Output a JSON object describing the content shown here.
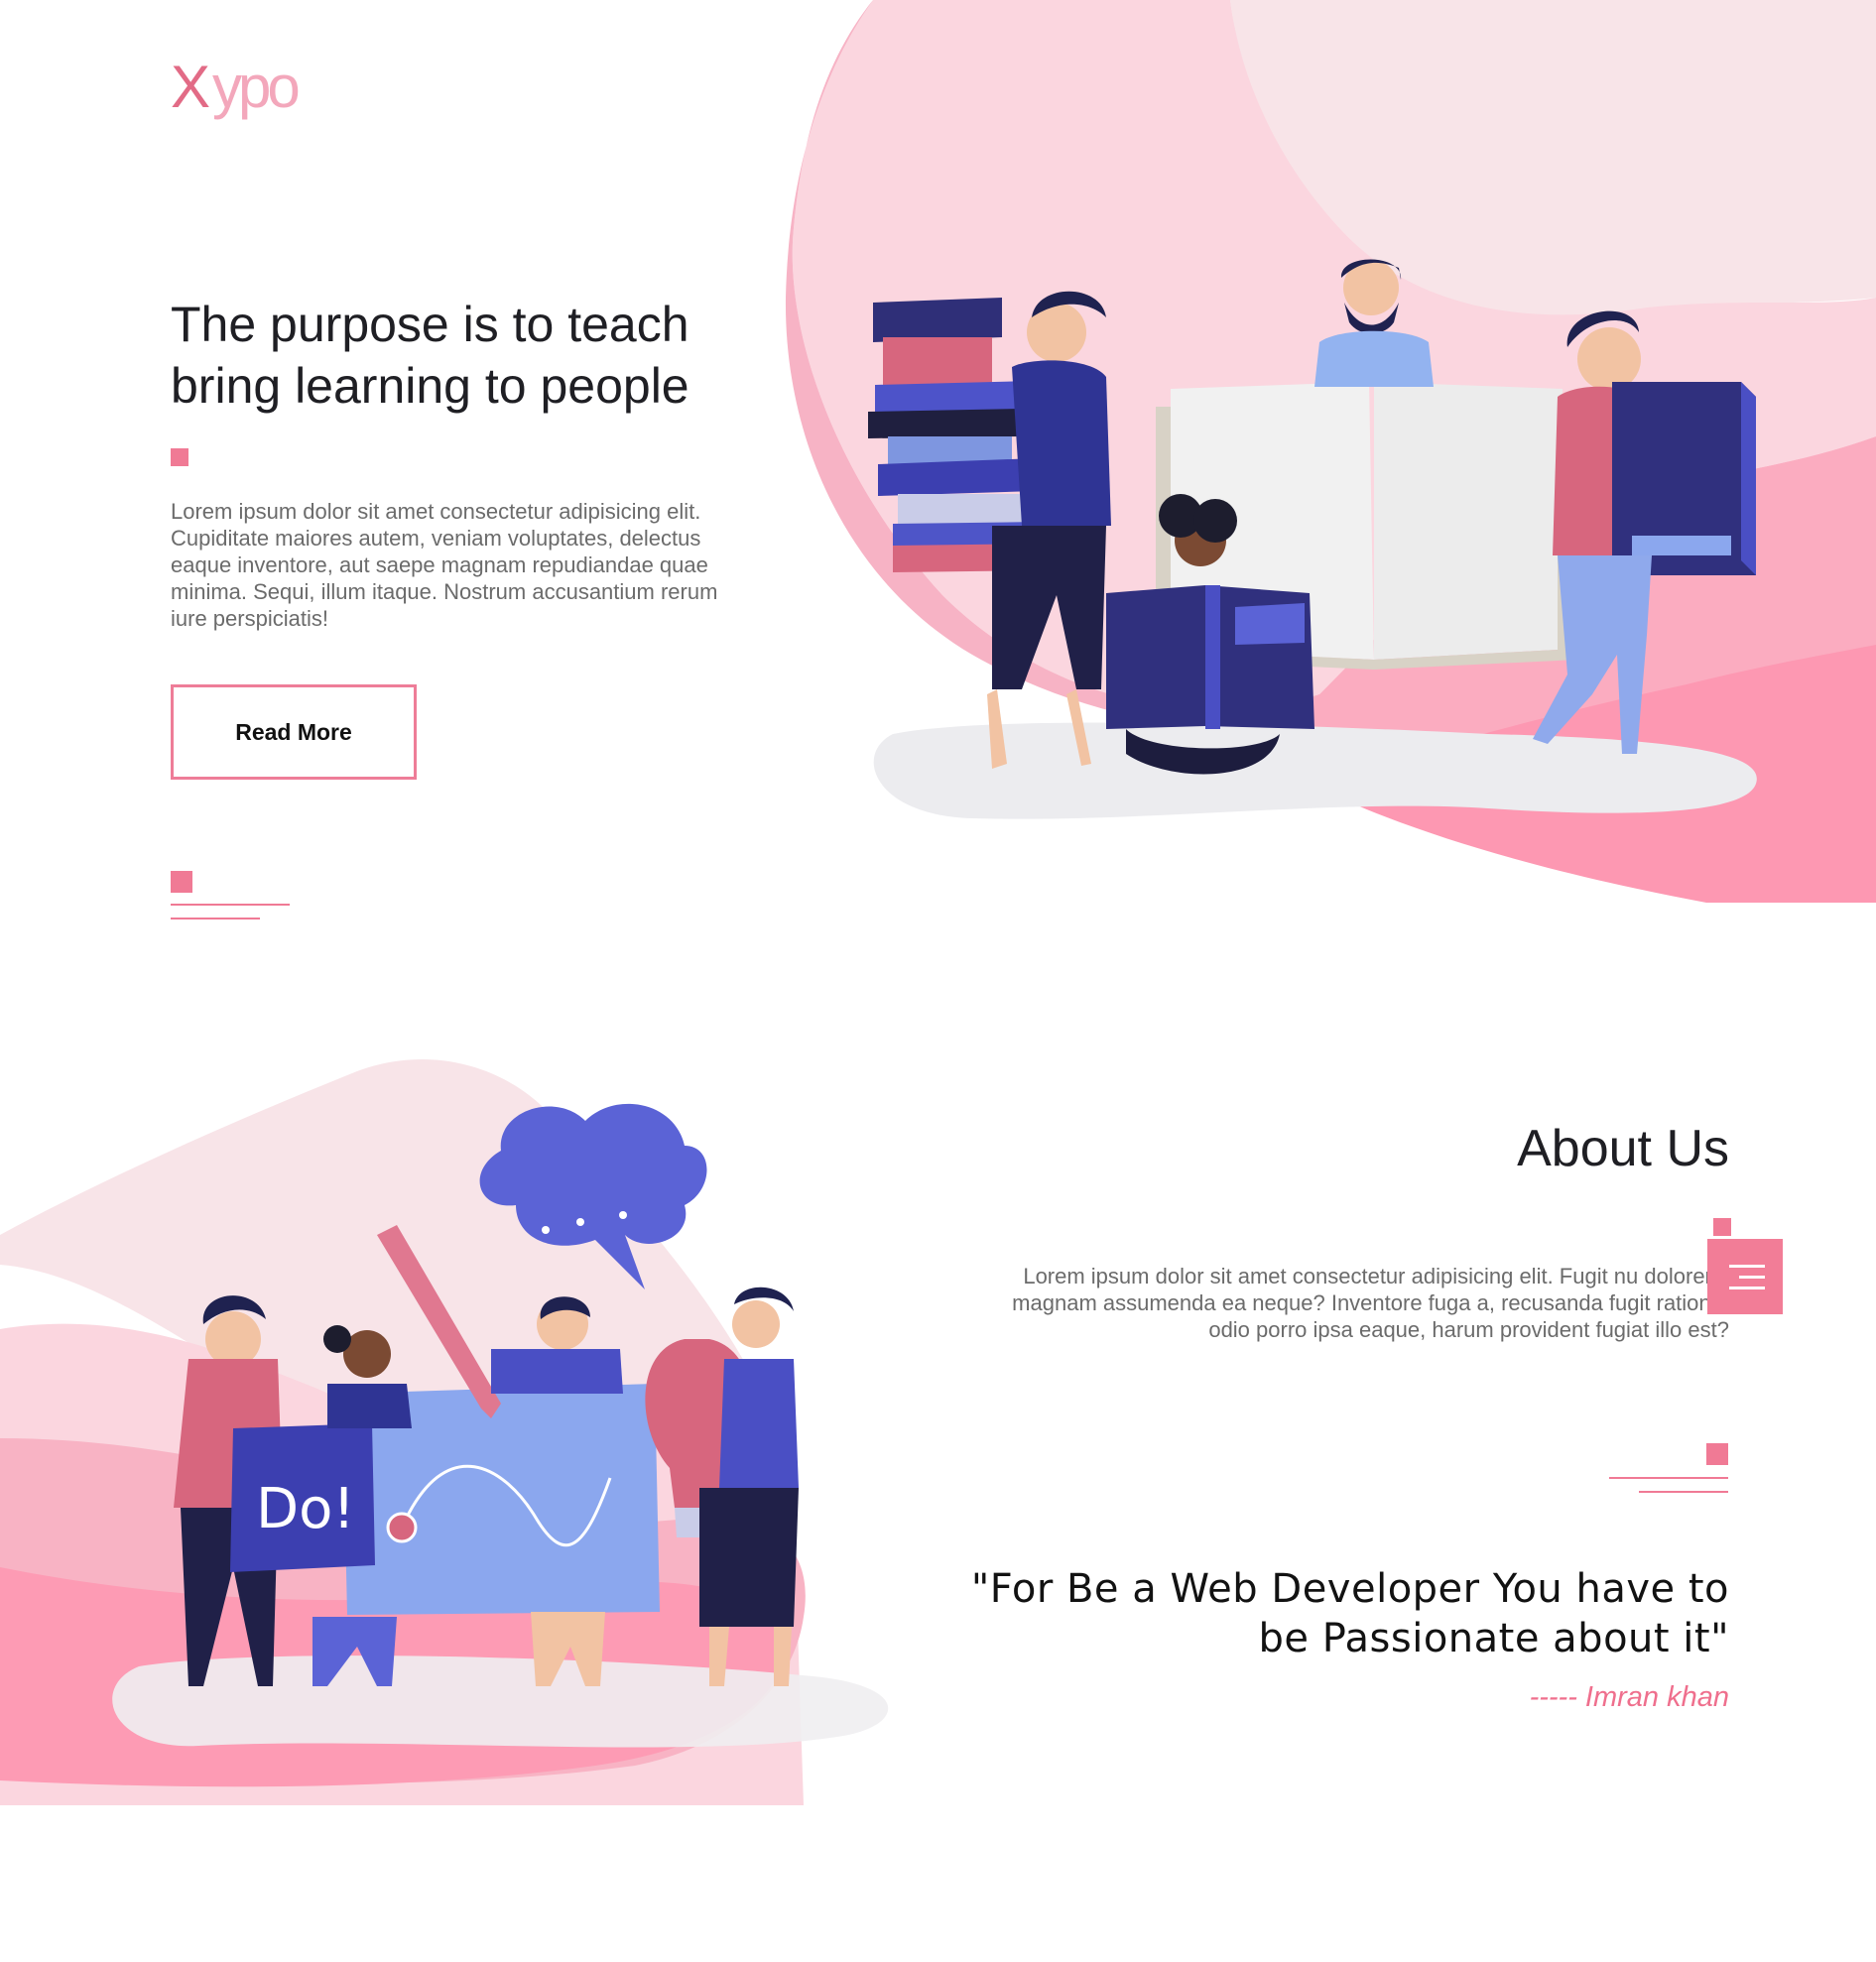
{
  "brand": {
    "logo_x": "X",
    "logo_rest": "ypo"
  },
  "hero": {
    "title_line1": "The purpose is to teach",
    "title_line2": "bring learning to people",
    "body": "Lorem ipsum dolor sit amet consectetur adipisicing elit. Cupiditate maiores autem, veniam voluptates, delectus eaque inventore, aut saepe magnam repudiandae quae minima. Sequi, illum itaque. Nostrum accusantium rerum iure perspiciatis!",
    "read_more_label": "Read More",
    "illustration_board_text": "",
    "illustration": "people-reading-books"
  },
  "about": {
    "title": "About Us",
    "body": "Lorem ipsum dolor sit amet consectetur adipisicing elit. Fugit nu dolorem, magnam assumenda ea neque? Inventore fuga a, recusanda fugit ratione, odio porro ipsa eaque, harum provident fugiat illo est?",
    "quote_line1": "\"For Be a Web Developer You have to",
    "quote_line2": "be Passionate about it\"",
    "author": "----- Imran khan",
    "sign_text": "Do!",
    "illustration": "team-brainstorm"
  },
  "menu": {
    "icon": "menu-icon"
  },
  "colors": {
    "accent": "#f07a95",
    "pink_light": "#fbdde4",
    "pink_mid": "#f8b3c4",
    "pink_strong": "#fd9bb4",
    "navy": "#2f2f78",
    "blue": "#4a4fc4",
    "text_dark": "#1f1f24",
    "text_gray": "#6b6b6b"
  }
}
